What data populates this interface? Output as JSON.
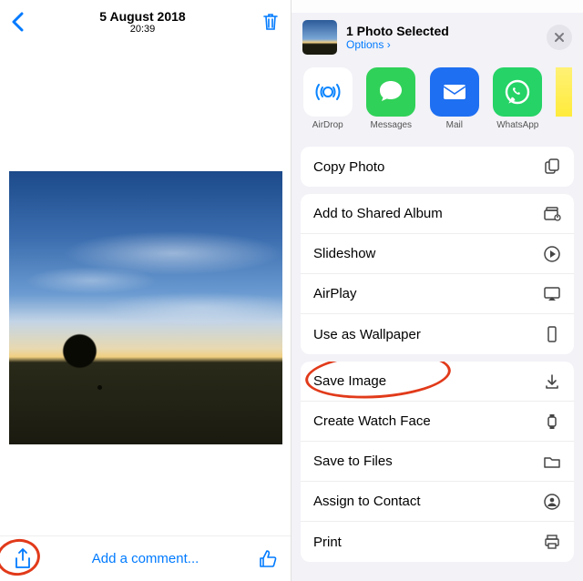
{
  "left": {
    "date": "5 August 2018",
    "time": "20:39",
    "comment_placeholder": "Add a comment..."
  },
  "sheet": {
    "selected": "1 Photo Selected",
    "options": "Options ›",
    "apps": [
      {
        "label": "AirDrop"
      },
      {
        "label": "Messages"
      },
      {
        "label": "Mail"
      },
      {
        "label": "WhatsApp"
      },
      {
        "label": ""
      }
    ],
    "group1": [
      {
        "label": "Copy Photo",
        "icon": "copy"
      }
    ],
    "group2": [
      {
        "label": "Add to Shared Album",
        "icon": "album"
      },
      {
        "label": "Slideshow",
        "icon": "play"
      },
      {
        "label": "AirPlay",
        "icon": "airplay"
      },
      {
        "label": "Use as Wallpaper",
        "icon": "phone"
      }
    ],
    "group3": [
      {
        "label": "Save Image",
        "icon": "download"
      },
      {
        "label": "Create Watch Face",
        "icon": "watch"
      },
      {
        "label": "Save to Files",
        "icon": "folder"
      },
      {
        "label": "Assign to Contact",
        "icon": "person"
      },
      {
        "label": "Print",
        "icon": "print"
      }
    ]
  },
  "annotations": {
    "share_button_circled": true,
    "save_image_circled": true
  }
}
